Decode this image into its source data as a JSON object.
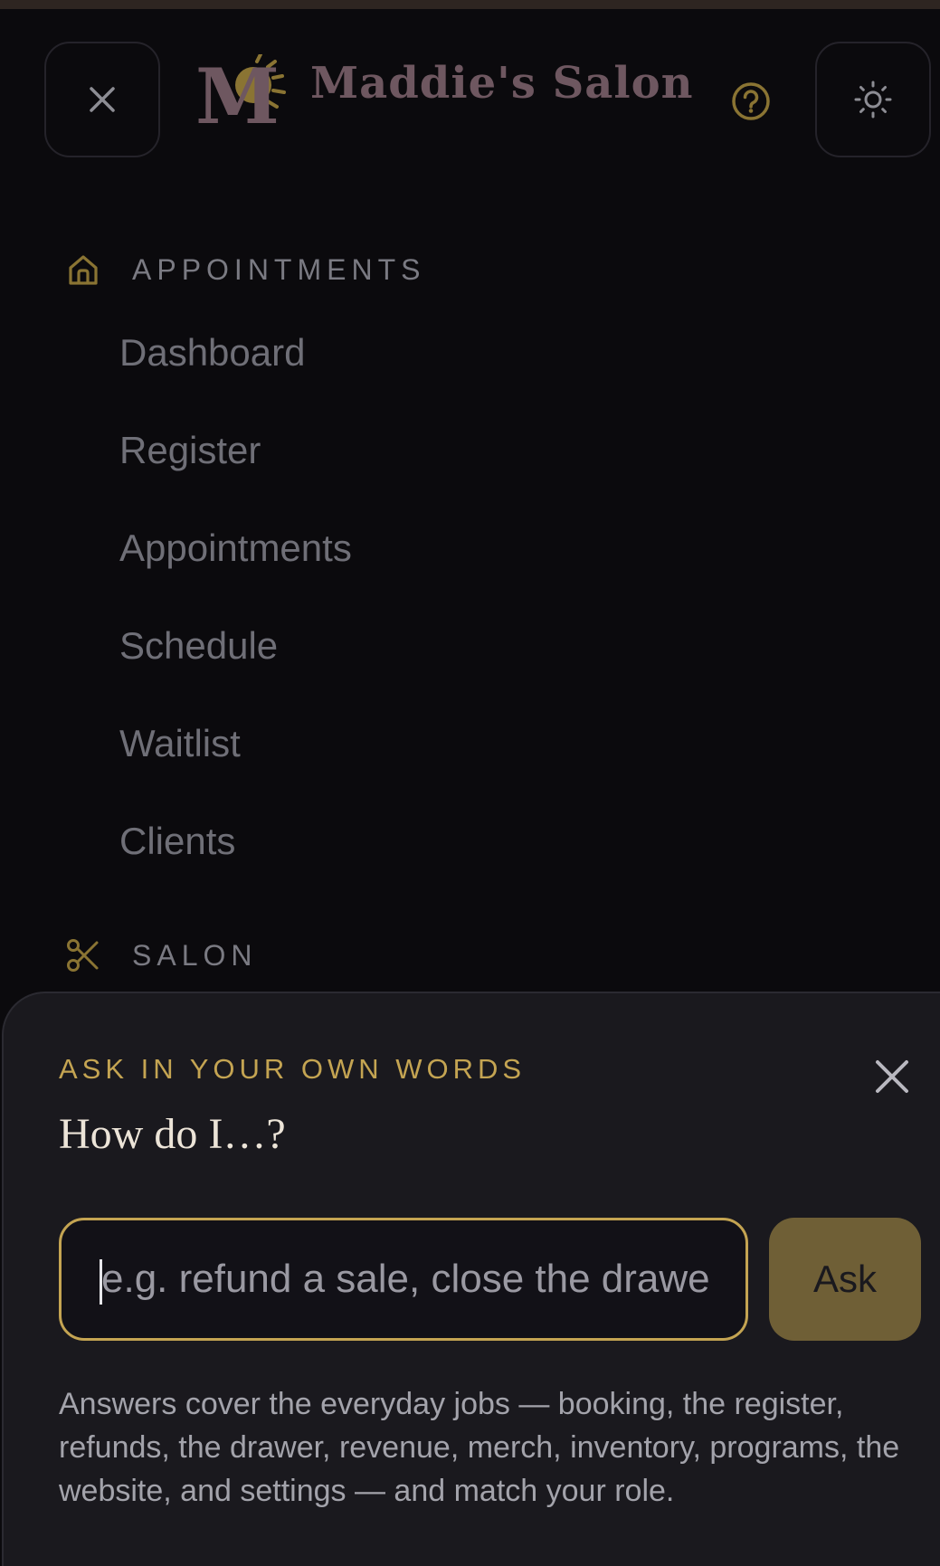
{
  "header": {
    "brand_name": "Maddie's Salon",
    "logo_letter": "M"
  },
  "nav": {
    "sections": [
      {
        "label": "APPOINTMENTS",
        "icon": "home-icon",
        "items": [
          "Dashboard",
          "Register",
          "Appointments",
          "Schedule",
          "Waitlist",
          "Clients"
        ]
      },
      {
        "label": "SALON",
        "icon": "scissors-icon",
        "items": []
      }
    ]
  },
  "help_sheet": {
    "eyebrow": "ASK IN YOUR OWN WORDS",
    "title": "How do I…?",
    "input_placeholder": "e.g. refund a sale, close the drawer",
    "input_value": "",
    "ask_label": "Ask",
    "help_text": "Answers cover the everyday jobs — booking, the register, refunds, the drawer, revenue, merch, inventory, programs, the website, and settings — and match your role."
  },
  "icons": {
    "close_menu": "close-icon",
    "help": "help-circle-icon",
    "theme": "sun-icon",
    "sheet_close": "close-icon"
  },
  "colors": {
    "background": "#0b0a0d",
    "sheet": "#1a191e",
    "accent_gold": "#c4a452",
    "brand_mauve": "#6e5760",
    "ask_button": "#6f5f36"
  }
}
